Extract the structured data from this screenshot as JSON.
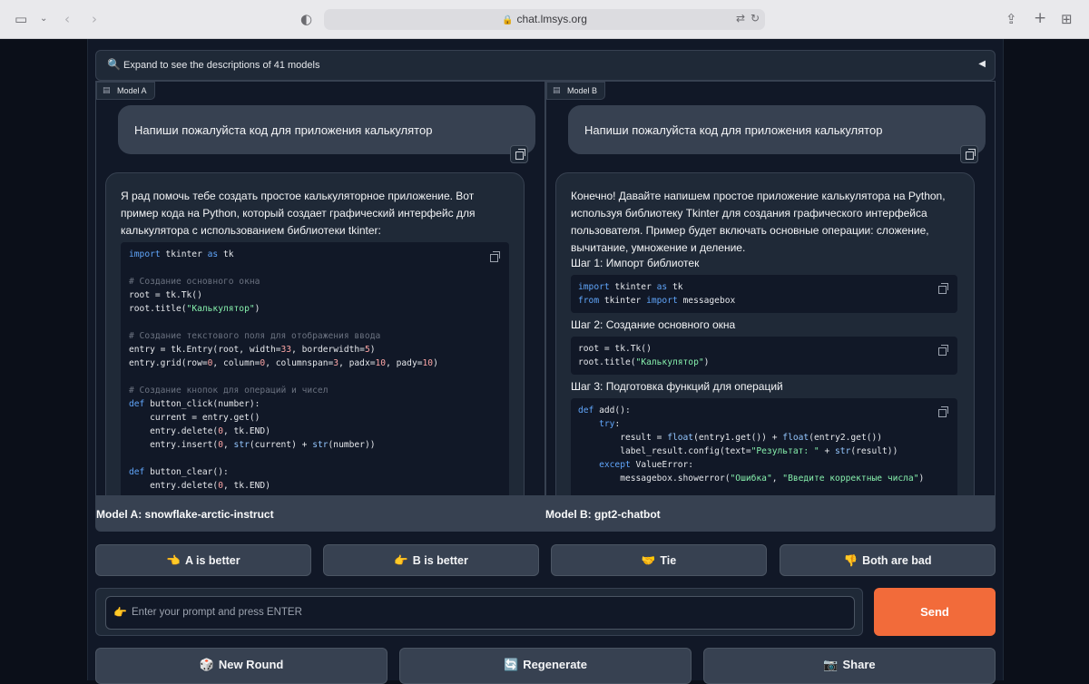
{
  "browser": {
    "url": "chat.lmsys.org"
  },
  "accordion": {
    "label": "Expand to see the descriptions of 41 models"
  },
  "model_a": {
    "badge": "Model A",
    "user_message": "Напиши пожалуйста код для приложения калькулятор",
    "response_intro": "Я рад помочь тебе создать простое калькуляторное приложение. Вот пример кода на Python, который создает графический интерфейс для калькулятора с использованием библиотеки tkinter:",
    "code_lines": [
      "import tkinter as tk",
      "",
      "# Создание основного окна",
      "root = tk.Tk()",
      "root.title(\"Калькулятор\")",
      "",
      "# Создание текстового поля для отображения ввода",
      "entry = tk.Entry(root, width=33, borderwidth=5)",
      "entry.grid(row=0, column=0, columnspan=3, padx=10, pady=10)",
      "",
      "# Создание кнопок для операций и чисел",
      "def button_click(number):",
      "    current = entry.get()",
      "    entry.delete(0, tk.END)",
      "    entry.insert(0, str(current) + str(number))",
      "",
      "def button_clear():",
      "    entry.delete(0, tk.END)"
    ],
    "name_label": "Model A: snowflake-arctic-instruct"
  },
  "model_b": {
    "badge": "Model B",
    "user_message": "Напиши пожалуйста код для приложения калькулятор",
    "response_intro": "Конечно! Давайте напишем простое приложение калькулятора на Python, используя библиотеку Tkinter для создания графического интерфейса пользователя. Пример будет включать основные операции: сложение, вычитание, умножение и деление.",
    "step1": "Шаг 1: Импорт библиотек",
    "code1": [
      "import tkinter as tk",
      "from tkinter import messagebox"
    ],
    "step2": "Шаг 2: Создание основного окна",
    "code2": [
      "root = tk.Tk()",
      "root.title(\"Калькулятор\")"
    ],
    "step3": "Шаг 3: Подготовка функций для операций",
    "code3": [
      "def add():",
      "    try:",
      "        result = float(entry1.get()) + float(entry2.get())",
      "        label_result.config(text=\"Результат: \" + str(result))",
      "    except ValueError:",
      "        messagebox.showerror(\"Ошибка\", \"Введите корректные числа\")"
    ],
    "name_label": "Model B: gpt2-chatbot"
  },
  "vote_buttons": [
    {
      "emoji": "👈",
      "label": "A is better"
    },
    {
      "emoji": "👉",
      "label": "B is better"
    },
    {
      "emoji": "🤝",
      "label": "Tie"
    },
    {
      "emoji": "👎",
      "label": "Both are bad"
    }
  ],
  "input": {
    "emoji": "👉",
    "placeholder": "Enter your prompt and press ENTER"
  },
  "send_label": "Send",
  "action_buttons": [
    {
      "emoji": "🎲",
      "label": "New Round"
    },
    {
      "emoji": "🔄",
      "label": "Regenerate"
    },
    {
      "emoji": "📷",
      "label": "Share"
    }
  ],
  "colors": {
    "background": "#0b0f19",
    "panel": "#111827",
    "send_button": "#f26b3a",
    "button": "#374151"
  }
}
